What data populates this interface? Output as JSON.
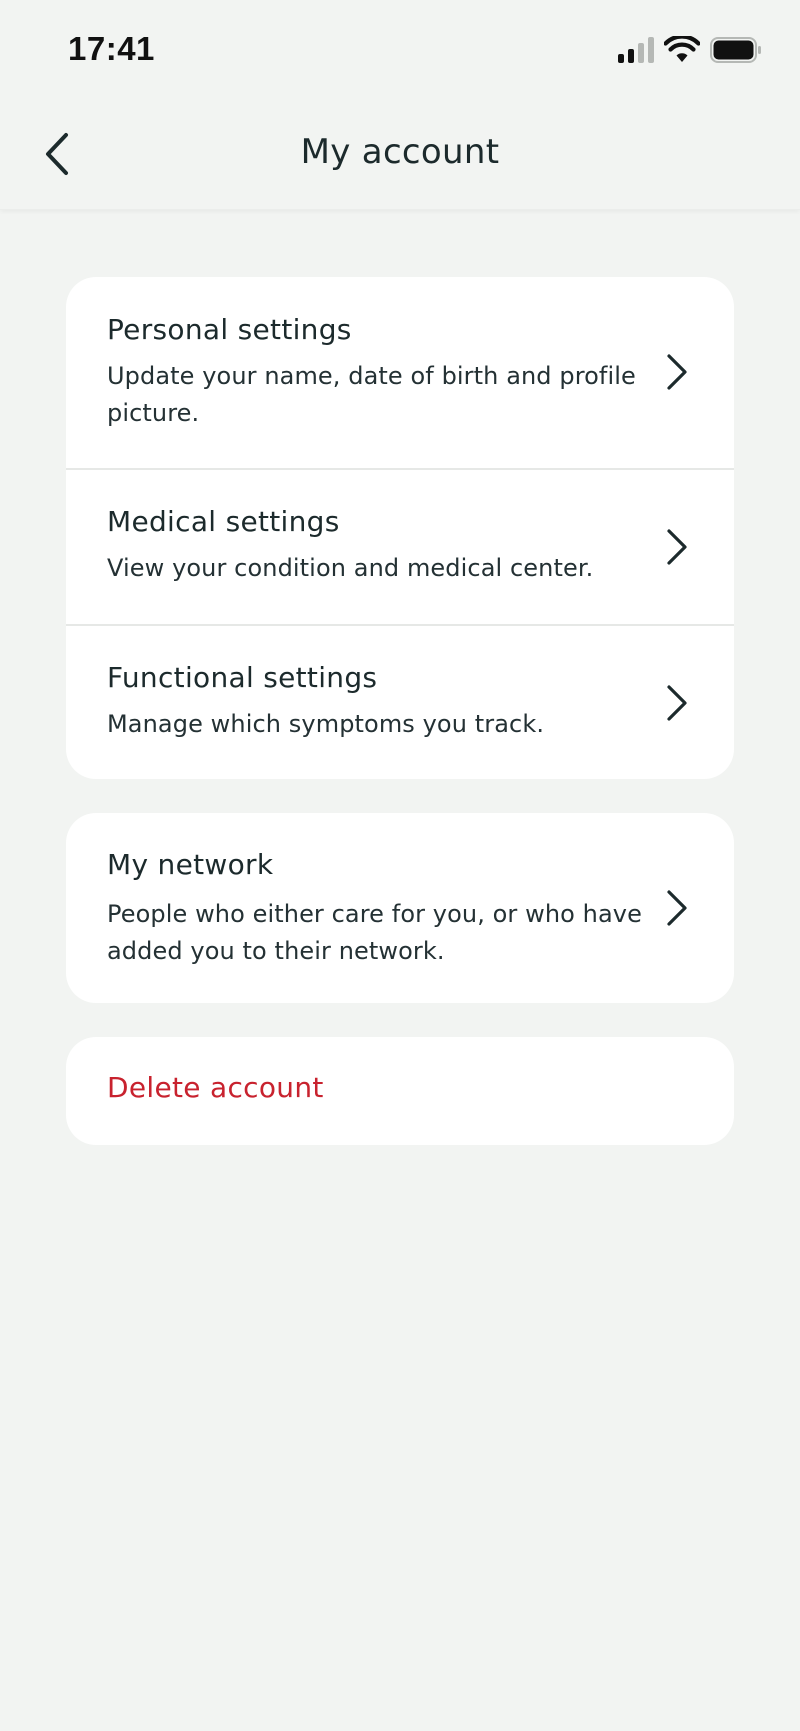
{
  "status_bar": {
    "time": "17:41",
    "icons": [
      "cellular-signal-icon",
      "wifi-icon",
      "battery-icon"
    ]
  },
  "header": {
    "title": "My account",
    "back_icon": "chevron-left-icon"
  },
  "sections": {
    "settings": [
      {
        "title": "Personal settings",
        "description": "Update your name, date of birth and profile picture."
      },
      {
        "title": "Medical settings",
        "description": "View your condition and medical center."
      },
      {
        "title": "Functional settings",
        "description": "Manage which symptoms you track."
      }
    ],
    "network": {
      "title": "My network",
      "description": "People who either care for you, or who have added you to their network."
    },
    "delete": {
      "label": "Delete account"
    }
  },
  "colors": {
    "background": "#f2f4f2",
    "card": "#ffffff",
    "text": "#1c2a2c",
    "danger": "#c8222e"
  }
}
